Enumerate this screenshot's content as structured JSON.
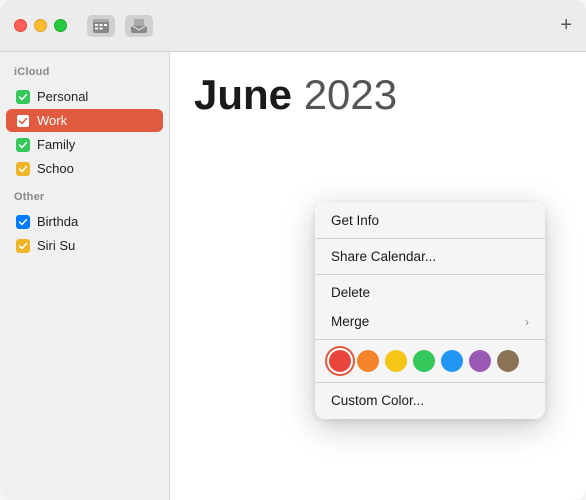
{
  "titlebar": {
    "plus_label": "+",
    "calendar_icon": "📅",
    "inbox_icon": "📥"
  },
  "sidebar": {
    "section_icloud": "iCloud",
    "section_other": "Other",
    "items": [
      {
        "id": "personal",
        "label": "Personal",
        "checked": true,
        "color": "green"
      },
      {
        "id": "work",
        "label": "Work",
        "checked": true,
        "color": "red",
        "selected": true
      },
      {
        "id": "family",
        "label": "Family",
        "checked": true,
        "color": "green"
      },
      {
        "id": "school",
        "label": "Schoo",
        "checked": true,
        "color": "yellow"
      }
    ],
    "other_items": [
      {
        "id": "birthdays",
        "label": "Birthda",
        "checked": true,
        "color": "blue"
      },
      {
        "id": "siri",
        "label": "Siri Su",
        "checked": true,
        "color": "yellow"
      }
    ]
  },
  "content": {
    "month": "June",
    "year": "2023"
  },
  "context_menu": {
    "items": [
      {
        "id": "get-info",
        "label": "Get Info",
        "has_arrow": false
      },
      {
        "id": "share-calendar",
        "label": "Share Calendar...",
        "has_arrow": false
      },
      {
        "id": "delete",
        "label": "Delete",
        "has_arrow": false
      },
      {
        "id": "merge",
        "label": "Merge",
        "has_arrow": true
      }
    ],
    "custom_color_label": "Custom Color...",
    "colors": [
      {
        "id": "red",
        "hex": "#e8453c",
        "selected": true
      },
      {
        "id": "orange",
        "hex": "#f5832a"
      },
      {
        "id": "yellow",
        "hex": "#f5c518"
      },
      {
        "id": "green",
        "hex": "#34c759"
      },
      {
        "id": "blue",
        "hex": "#2196f3"
      },
      {
        "id": "purple",
        "hex": "#9b59b6"
      },
      {
        "id": "brown",
        "hex": "#8b7355"
      }
    ]
  }
}
